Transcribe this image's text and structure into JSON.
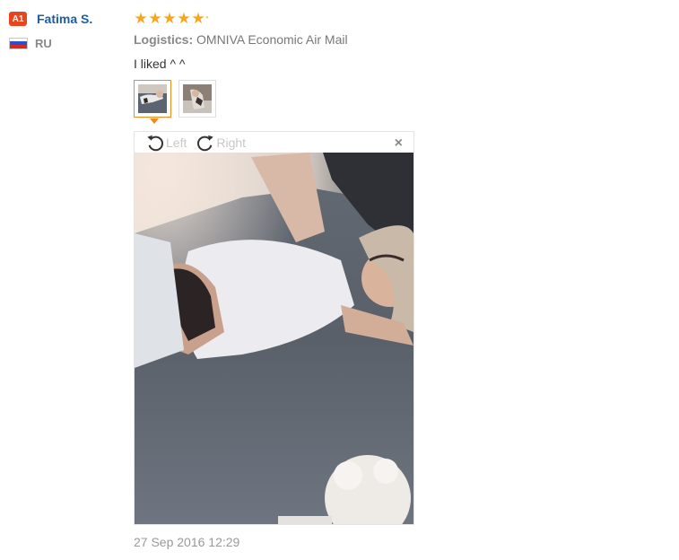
{
  "reviewer": {
    "level_badge": "A1",
    "name": "Fatima S.",
    "country_code": "RU",
    "flag_colors": [
      "#ffffff",
      "#2b4fd0",
      "#d52b1e"
    ]
  },
  "review": {
    "rating": 5,
    "logistics_label": "Logistics:",
    "logistics_value": "OMNIVA Economic Air Mail",
    "text": "I liked ^ ^",
    "date": "27 Sep 2016 12:29"
  },
  "viewer": {
    "rotate_left_label": "Left",
    "rotate_right_label": "Right",
    "close_glyph": "×"
  },
  "icons": {
    "star": "star-icon",
    "rotate_left": "rotate-left-icon",
    "rotate_right": "rotate-right-icon",
    "close": "close-icon"
  },
  "colors": {
    "accent_orange": "#f08a1c",
    "star": "#f5a623",
    "name_link": "#1a5ea8",
    "badge": "#e8451d"
  }
}
